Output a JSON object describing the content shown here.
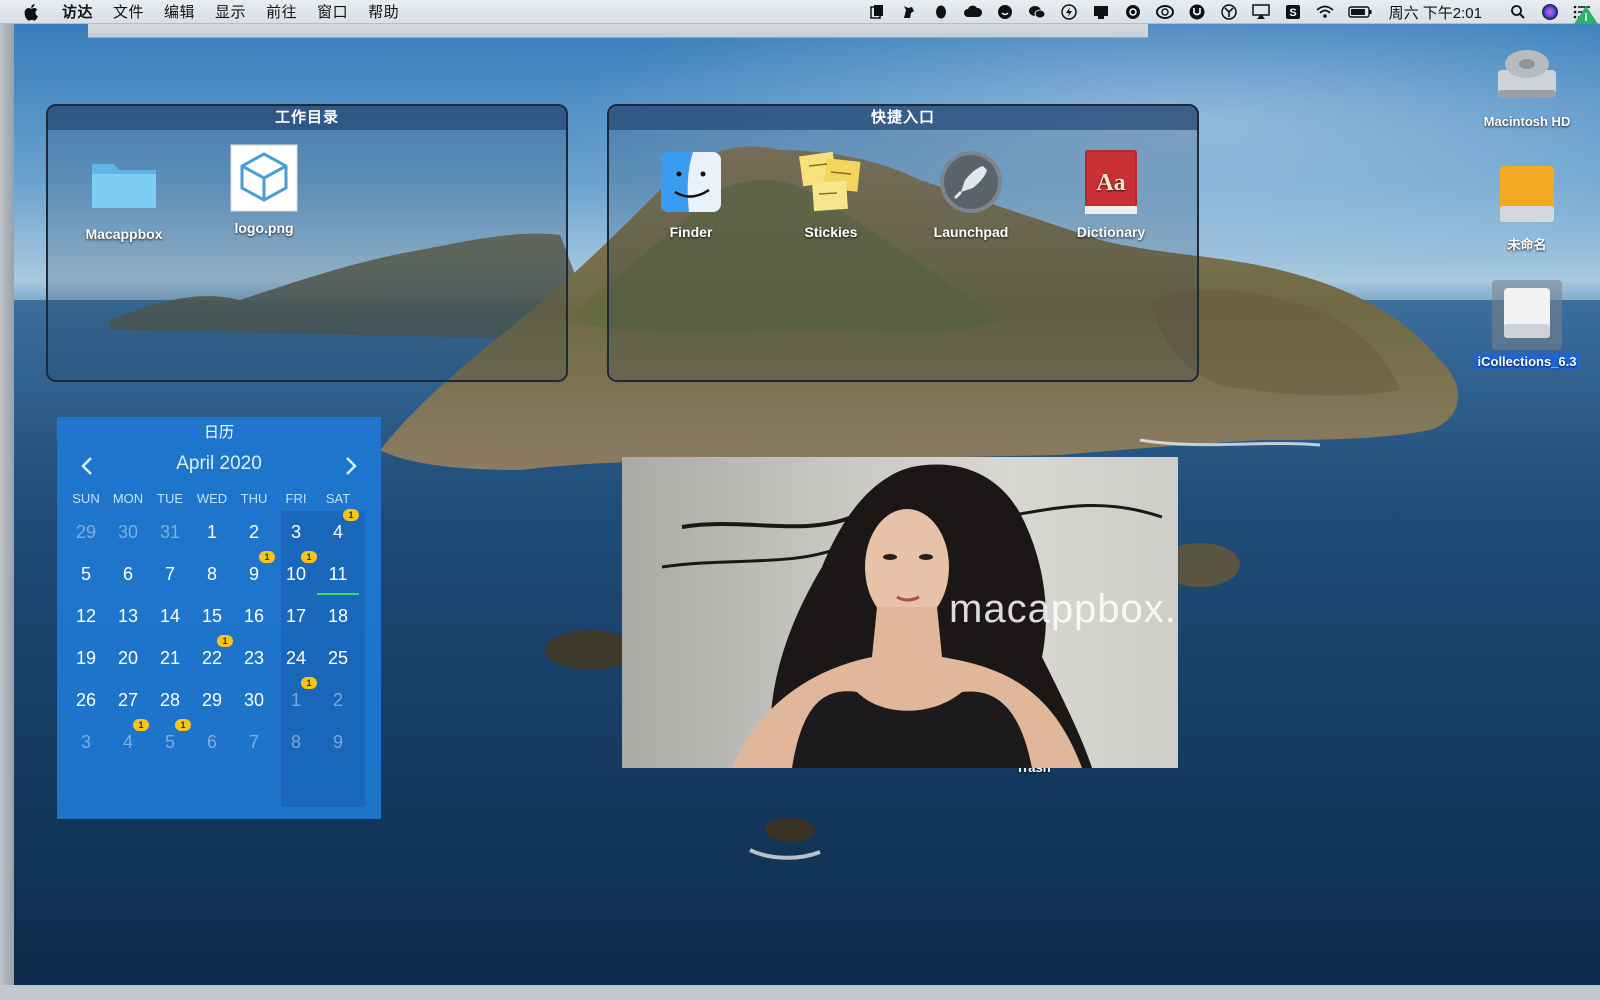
{
  "menubar": {
    "items": [
      "访达",
      "文件",
      "编辑",
      "显示",
      "前往",
      "窗口",
      "帮助"
    ],
    "clock": "周六 下午2:01",
    "status_icons": [
      "clipboard-icon",
      "dog-icon",
      "qq-penguin-icon",
      "cloud-icon",
      "smile-face-icon",
      "wechat-icon",
      "lightning-icon",
      "notification-icon",
      "spiral-icon",
      "creative-cloud-icon",
      "u-shield-icon",
      "y-icon",
      "airplay-icon",
      "sogou-s-icon",
      "wifi-icon",
      "battery-icon",
      "search-icon",
      "siri-icon",
      "list-icon"
    ]
  },
  "workdir_panel": {
    "title": "工作目录",
    "items": [
      {
        "label": "Macappbox",
        "icon": "folder-icon"
      },
      {
        "label": "logo.png",
        "icon": "image-file-icon"
      }
    ]
  },
  "quick_panel": {
    "title": "快捷入口",
    "items": [
      {
        "label": "Finder",
        "icon": "finder-icon"
      },
      {
        "label": "Stickies",
        "icon": "stickies-icon"
      },
      {
        "label": "Launchpad",
        "icon": "launchpad-icon"
      },
      {
        "label": "Dictionary",
        "icon": "dictionary-icon"
      }
    ],
    "dictionary_icon_text": "Aa"
  },
  "calendar": {
    "title": "日历",
    "month_label": "April 2020",
    "weekdays": [
      "SUN",
      "MON",
      "TUE",
      "WED",
      "THU",
      "FRI",
      "SAT"
    ],
    "weeks": [
      [
        {
          "d": "29",
          "other": true
        },
        {
          "d": "30",
          "other": true
        },
        {
          "d": "31",
          "other": true
        },
        {
          "d": "1"
        },
        {
          "d": "2"
        },
        {
          "d": "3"
        },
        {
          "d": "4",
          "badge": "1"
        }
      ],
      [
        {
          "d": "5"
        },
        {
          "d": "6"
        },
        {
          "d": "7"
        },
        {
          "d": "8"
        },
        {
          "d": "9",
          "badge": "1"
        },
        {
          "d": "10",
          "badge": "1"
        },
        {
          "d": "11",
          "today": true
        }
      ],
      [
        {
          "d": "12"
        },
        {
          "d": "13"
        },
        {
          "d": "14"
        },
        {
          "d": "15"
        },
        {
          "d": "16"
        },
        {
          "d": "17"
        },
        {
          "d": "18"
        }
      ],
      [
        {
          "d": "19"
        },
        {
          "d": "20"
        },
        {
          "d": "21"
        },
        {
          "d": "22",
          "badge": "1"
        },
        {
          "d": "23"
        },
        {
          "d": "24"
        },
        {
          "d": "25"
        }
      ],
      [
        {
          "d": "26"
        },
        {
          "d": "27"
        },
        {
          "d": "28"
        },
        {
          "d": "29"
        },
        {
          "d": "30"
        },
        {
          "d": "1",
          "other": true,
          "badge": "1"
        },
        {
          "d": "2",
          "other": true
        }
      ],
      [
        {
          "d": "3",
          "other": true
        },
        {
          "d": "4",
          "other": true,
          "badge": "1"
        },
        {
          "d": "5",
          "other": true,
          "badge": "1"
        },
        {
          "d": "6",
          "other": true
        },
        {
          "d": "7",
          "other": true
        },
        {
          "d": "8",
          "other": true
        },
        {
          "d": "9",
          "other": true
        }
      ]
    ],
    "accent": "#1e78d2",
    "today_underline": "#3ddc6a",
    "badge_color": "#f7c51a"
  },
  "photo": {
    "watermark": "macappbox.com"
  },
  "desktop_icons": [
    {
      "label": "Macintosh HD",
      "icon": "hard-drive-icon"
    },
    {
      "label": "未命名",
      "icon": "external-drive-icon"
    },
    {
      "label": "iCollections_6.3",
      "icon": "disk-image-icon",
      "selected": true
    }
  ],
  "trash_label": "Trash"
}
